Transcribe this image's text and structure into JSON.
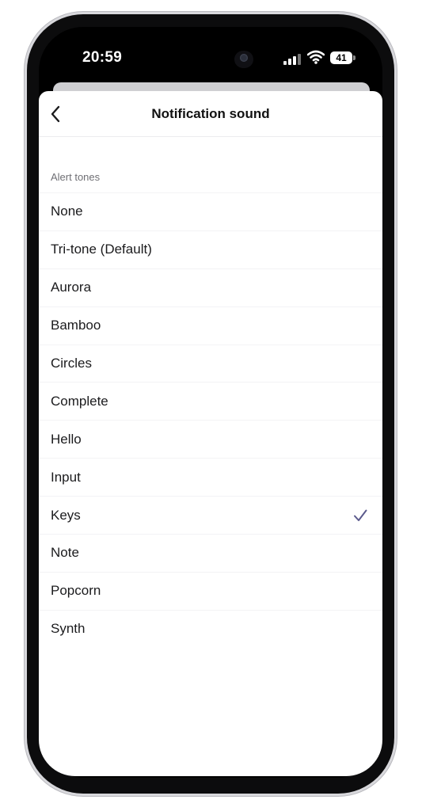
{
  "status_bar": {
    "time": "20:59",
    "battery": "41"
  },
  "header": {
    "title": "Notification sound"
  },
  "section": {
    "label": "Alert tones"
  },
  "tones": [
    {
      "label": "None",
      "selected": false
    },
    {
      "label": "Tri-tone (Default)",
      "selected": false
    },
    {
      "label": "Aurora",
      "selected": false
    },
    {
      "label": "Bamboo",
      "selected": false
    },
    {
      "label": "Circles",
      "selected": false
    },
    {
      "label": "Complete",
      "selected": false
    },
    {
      "label": "Hello",
      "selected": false
    },
    {
      "label": "Input",
      "selected": false
    },
    {
      "label": "Keys",
      "selected": true
    },
    {
      "label": "Note",
      "selected": false
    },
    {
      "label": "Popcorn",
      "selected": false
    },
    {
      "label": "Synth",
      "selected": false
    }
  ],
  "colors": {
    "checkmark": "#5b5a8c",
    "text": "#1b1b1d",
    "section_label": "#6f6f74"
  },
  "icons": {
    "back": "chevron-left-icon",
    "selected": "checkmark-icon"
  }
}
